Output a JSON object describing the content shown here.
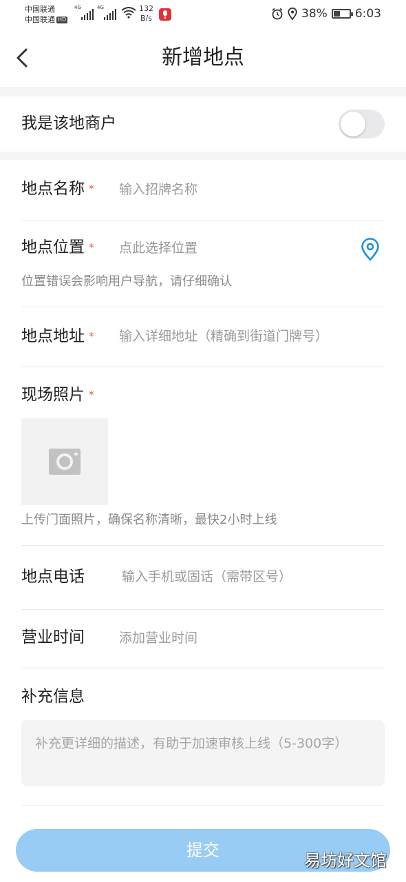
{
  "status_bar": {
    "carrier_1": "中国联通",
    "carrier_2": "中国联通",
    "hd_badge": "HD",
    "signal_1_label": "4G",
    "signal_2_label": "4G",
    "speed_value": "132",
    "speed_unit": "B/s",
    "battery": "38%",
    "battery_level": 0.38,
    "time": "6:03",
    "icons": [
      "signal-icon",
      "wifi-icon",
      "mic-recording-icon",
      "alarm-icon",
      "location-icon",
      "battery-icon"
    ]
  },
  "header": {
    "title": "新增地点",
    "back_icon": "chevron-left-icon"
  },
  "merchant_toggle": {
    "label": "我是该地商户",
    "on": false
  },
  "form": {
    "name": {
      "label": "地点名称",
      "required_mark": "*",
      "placeholder": "输入招牌名称"
    },
    "location": {
      "label": "地点位置",
      "required_mark": "*",
      "placeholder": "点此选择位置",
      "hint": "位置错误会影响用户导航，请仔细确认",
      "icon": "location-pin-icon"
    },
    "address": {
      "label": "地点地址",
      "required_mark": "*",
      "placeholder": "输入详细地址（精确到街道门牌号）"
    },
    "photo": {
      "label": "现场照片",
      "required_mark": "*",
      "hint": "上传门面照片，确保名称清晰，最快2小时上线",
      "icon": "camera-icon"
    },
    "phone": {
      "label": "地点电话",
      "placeholder": "输入手机或固话（需带区号）"
    },
    "hours": {
      "label": "营业时间",
      "placeholder": "添加营业时间"
    },
    "extra": {
      "label": "补充信息",
      "placeholder": "补充更详细的描述，有助于加速审核上线（5-300字）"
    }
  },
  "submit_label": "提交",
  "watermark": "易坊好文馆",
  "colors": {
    "accent": "#1e8fe0",
    "required": "#e05a3c",
    "submit_bg": "#98ccf5",
    "section_gap": "#f4f5f7"
  }
}
